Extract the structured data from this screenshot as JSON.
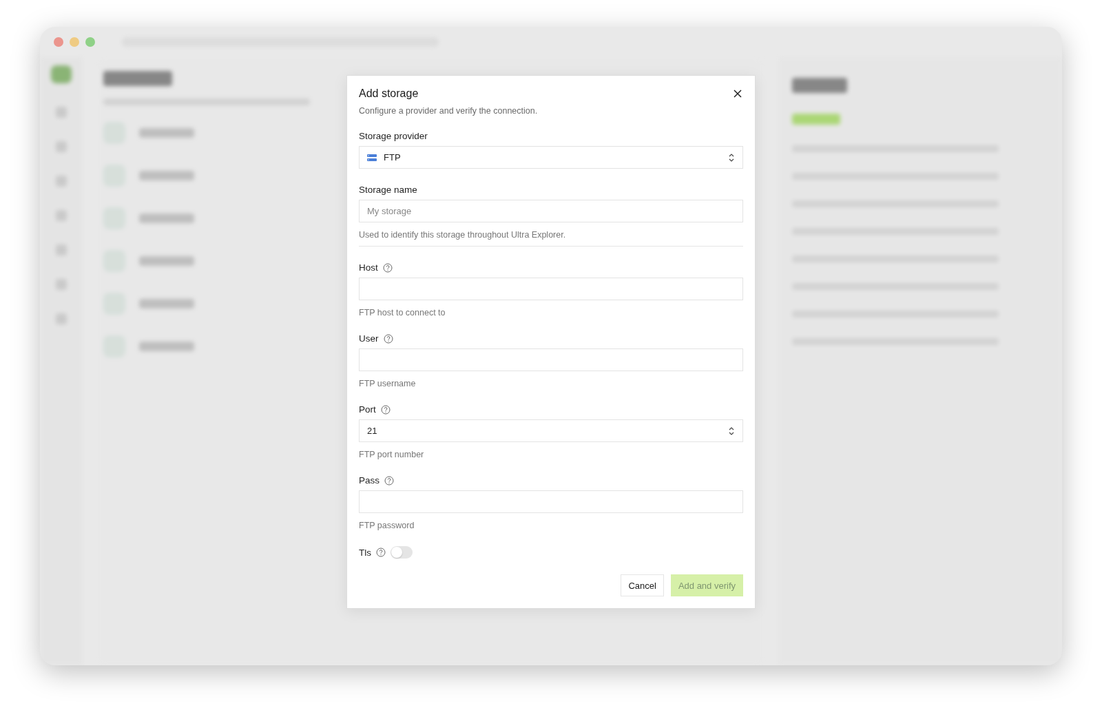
{
  "dialog": {
    "title": "Add storage",
    "subtitle": "Configure a provider and verify the connection.",
    "fields": [
      {
        "kind": "select",
        "label": "Storage provider",
        "help": false,
        "value": "FTP"
      },
      {
        "kind": "text",
        "label": "Storage name",
        "help": false,
        "placeholder": "My storage",
        "hint": "Used to identify this storage throughout Ultra Explorer.",
        "divider": true
      },
      {
        "kind": "text",
        "label": "Host",
        "help": true,
        "hint": "FTP host to connect to"
      },
      {
        "kind": "text",
        "label": "User",
        "help": true,
        "hint": "FTP username"
      },
      {
        "kind": "number",
        "label": "Port",
        "help": true,
        "value": "21",
        "hint": "FTP port number"
      },
      {
        "kind": "text",
        "label": "Pass",
        "help": true,
        "hint": "FTP password"
      },
      {
        "kind": "toggle",
        "label": "Tls",
        "help": true,
        "on": false
      }
    ],
    "buttons": [
      {
        "kind": "secondary",
        "label": "Cancel",
        "disabled": false
      },
      {
        "kind": "primary",
        "label": "Add and verify",
        "disabled": true
      }
    ]
  }
}
